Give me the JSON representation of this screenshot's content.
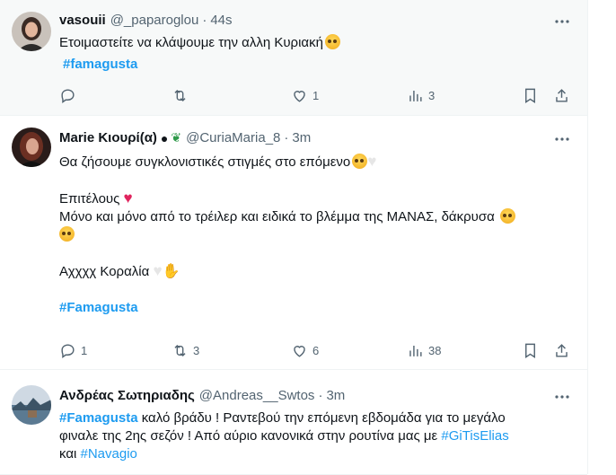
{
  "tweets": [
    {
      "name": "vasouii",
      "handle": "@_paparoglou",
      "sep": "·",
      "time": "44s",
      "text_line1": "Ετοιμαστείτε να κλάψουμε την αλλη Κυριακή",
      "hashtag": "#famagusta",
      "replies": "",
      "retweets": "",
      "likes": "1",
      "views": "3"
    },
    {
      "name": "Marie Κιουρί(α)",
      "handle": "@CuriaMaria_8",
      "sep": "·",
      "time": "3m",
      "line1": "Θα ζήσουμε συγκλονιστικές στιγμές στο επόμενο",
      "line2": "Επιτέλους",
      "line3": "Μόνο και μόνο από το τρέιλερ και ειδικά το βλέμμα της ΜΑΝΑΣ, δάκρυσα",
      "line4": "Αχχχχ Κοραλία",
      "hashtag": "#Famagusta",
      "replies": "1",
      "retweets": "3",
      "likes": "6",
      "views": "38"
    },
    {
      "name": "Ανδρέας Σωτηριαδης",
      "handle": "@Andreas__Swtos",
      "sep": "·",
      "time": "3m",
      "hashtag": "#Famagusta",
      "text_a": " καλό βράδυ ! Ραντεβού την επόμενη εβδομάδα για το μεγάλο",
      "text_b": "φιναλε της 2ης σεζόν ! Από αύριο κανονικά στην ρουτίνα μας με ",
      "tag2": "#GiTisElias",
      "text_c": "και ",
      "tag3": "#Navagio"
    }
  ],
  "icons": {
    "reply": "reply-icon",
    "retweet": "retweet-icon",
    "like": "like-icon",
    "views": "views-icon",
    "bookmark": "bookmark-icon",
    "share": "share-icon",
    "more": "more-icon"
  },
  "colors": {
    "accent": "#1d9bf0",
    "secondary_text": "#536471",
    "hover_bg": "#f7f9f9"
  }
}
